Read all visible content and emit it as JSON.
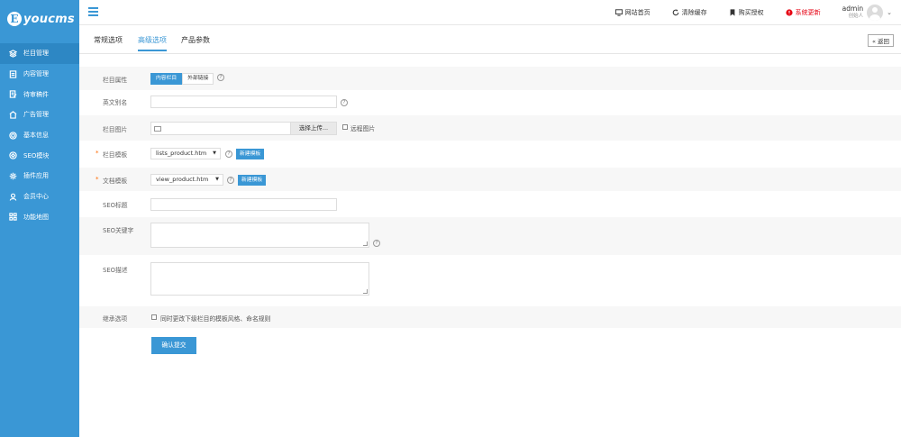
{
  "brand": {
    "logo_letter": "E",
    "logo_text": "youcms"
  },
  "sidebar": {
    "items": [
      {
        "label": "栏目管理",
        "icon": "layers-icon",
        "active": true
      },
      {
        "label": "内容管理",
        "icon": "document-icon",
        "active": false
      },
      {
        "label": "待审稿件",
        "icon": "draft-icon",
        "active": false
      },
      {
        "label": "广告管理",
        "icon": "ad-icon",
        "active": false
      },
      {
        "label": "基本信息",
        "icon": "gear-icon",
        "active": false
      },
      {
        "label": "SEO模块",
        "icon": "seo-icon",
        "active": false
      },
      {
        "label": "插件应用",
        "icon": "plugin-icon",
        "active": false
      },
      {
        "label": "会员中心",
        "icon": "user-icon",
        "active": false
      },
      {
        "label": "功能地图",
        "icon": "grid-icon",
        "active": false
      }
    ]
  },
  "header": {
    "links": [
      {
        "label": "网站首页",
        "icon": "monitor-icon"
      },
      {
        "label": "清除缓存",
        "icon": "refresh-icon"
      },
      {
        "label": "购买授权",
        "icon": "bookmark-icon"
      },
      {
        "label": "系统更新",
        "icon": "alert-icon"
      }
    ],
    "user": {
      "name": "admin",
      "role": "创始人"
    }
  },
  "tabs": [
    {
      "label": "常规选项",
      "active": false
    },
    {
      "label": "高级选项",
      "active": true
    },
    {
      "label": "产品参数",
      "active": false
    }
  ],
  "back_label": "« 返回",
  "form": {
    "attr": {
      "label": "栏目属性",
      "opt_on": "内容栏目",
      "opt_off": "外部链接"
    },
    "alias": {
      "label": "英文别名",
      "value": ""
    },
    "image": {
      "label": "栏目图片",
      "upload_label": "选择上传...",
      "remote_label": "远程图片"
    },
    "list_tpl": {
      "required": "*",
      "label": "栏目模板",
      "value": "lists_product.htm",
      "new_label": "新建模板"
    },
    "view_tpl": {
      "required": "*",
      "label": "文档模板",
      "value": "view_product.htm",
      "new_label": "新建模板"
    },
    "seo_title": {
      "label": "SEO标题",
      "value": ""
    },
    "seo_keywords": {
      "label": "SEO关键字",
      "value": ""
    },
    "seo_desc": {
      "label": "SEO描述",
      "value": ""
    },
    "inherit": {
      "label": "继承选项",
      "option": "同时更改下级栏目的模板风格、命名规则"
    },
    "submit_label": "确认提交",
    "help_glyph": "?"
  },
  "colors": {
    "primary": "#3a97d5",
    "required": "#ff6a00",
    "update": "#e60012"
  }
}
